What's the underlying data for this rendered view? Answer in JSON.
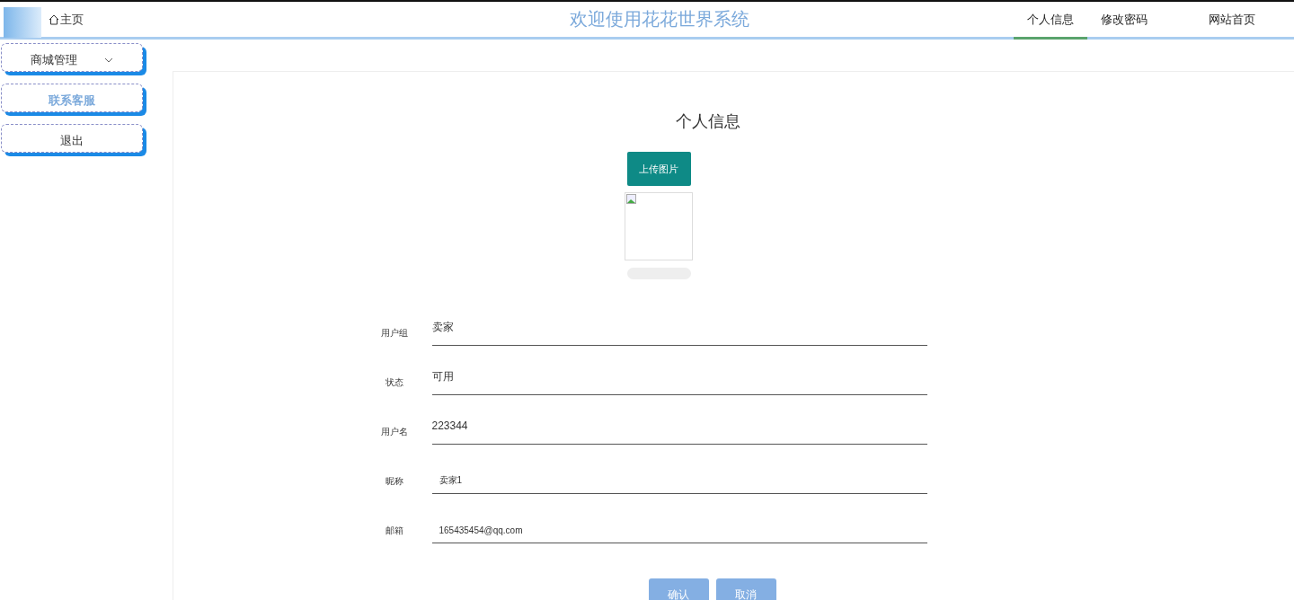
{
  "header": {
    "home_label": "主页",
    "title": "欢迎使用花花世界系统",
    "nav": [
      {
        "label": "个人信息",
        "selected": true
      },
      {
        "label": "修改密码",
        "selected": false
      },
      {
        "label": "网站首页",
        "selected": false
      }
    ]
  },
  "sidebar": {
    "items": [
      {
        "label": "商城管理",
        "kind": "dropdown",
        "active": false
      },
      {
        "label": "联系客服",
        "kind": "link",
        "active": true
      },
      {
        "label": "退出",
        "kind": "link",
        "active": false
      }
    ]
  },
  "page_title": "个人信息",
  "upload_button": "上传图片",
  "upload_progress": {
    "level": 0
  },
  "form": [
    {
      "label": "用户组",
      "value": "卖家",
      "kind": "display"
    },
    {
      "label": "状态",
      "value": "可用",
      "kind": "display"
    },
    {
      "label": "用户名",
      "value": "223344",
      "kind": "display"
    },
    {
      "label": "昵称",
      "value": "卖家1",
      "kind": "input"
    },
    {
      "label": "邮箱",
      "value": "165435454@qq.com",
      "kind": "input"
    }
  ],
  "buttons": [
    "确认",
    "取消"
  ]
}
